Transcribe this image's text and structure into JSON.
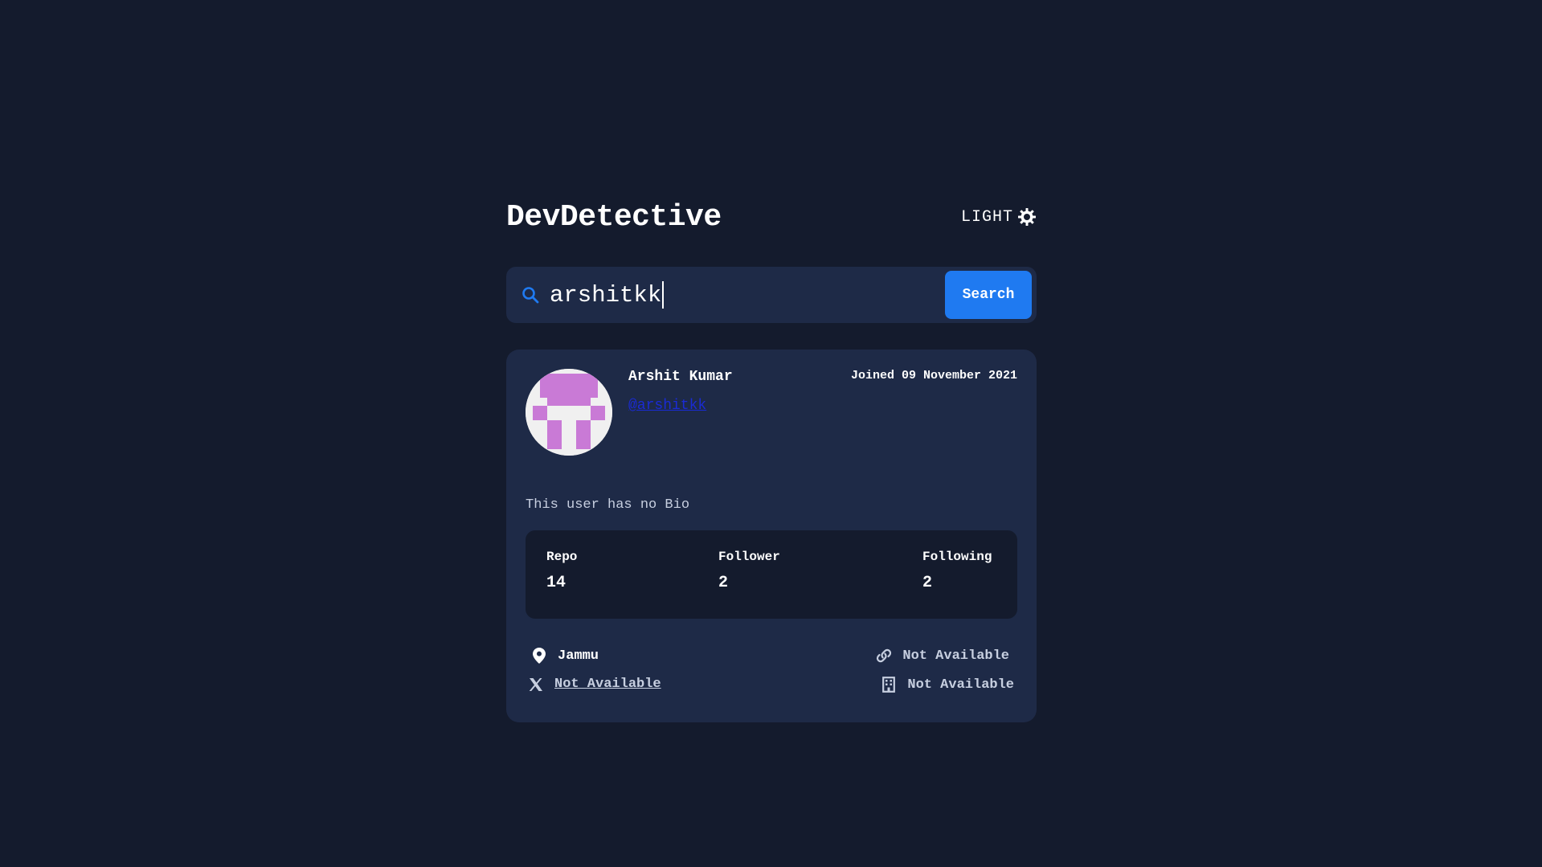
{
  "app": {
    "title": "DevDetective",
    "mode_label": "LIGHT"
  },
  "search": {
    "value": "arshitkk",
    "button_label": "Search"
  },
  "profile": {
    "name": "Arshit Kumar",
    "handle": "@arshitkk",
    "joined": "Joined 09 November 2021",
    "bio": "This user has no Bio",
    "stats": [
      {
        "label": "Repo",
        "value": "14"
      },
      {
        "label": "Follower",
        "value": "2"
      },
      {
        "label": "Following",
        "value": "2"
      }
    ],
    "location": "Jammu",
    "website": "Not Available",
    "twitter": "Not Available",
    "company": "Not Available"
  },
  "colors": {
    "background": "#141b2d",
    "card": "#1e2a47",
    "accent": "#1f7af1",
    "handle_link": "#1a2bd6",
    "avatar_pixel": "#c97ad6"
  },
  "icons": {
    "mode": "sun-icon",
    "search": "search-icon",
    "location": "location-pin-icon",
    "website": "link-icon",
    "twitter": "x-twitter-icon",
    "company": "building-icon"
  }
}
